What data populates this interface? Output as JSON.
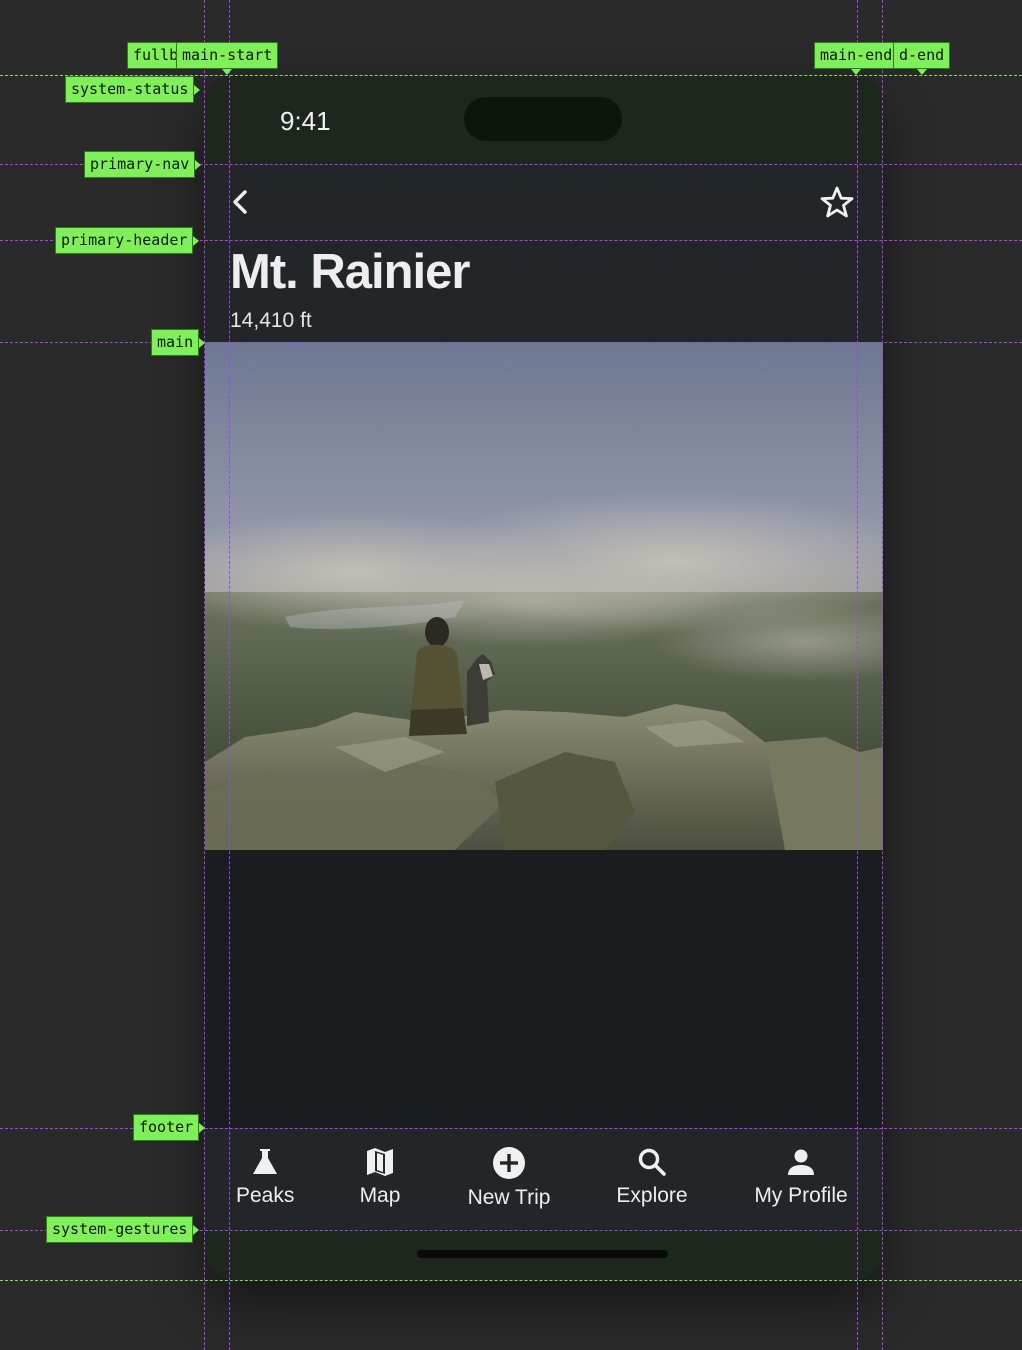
{
  "guides": {
    "fullbleed_start": "fullb",
    "main_start": "main-start",
    "main_end": "main-end",
    "fullbleed_end": "d-end",
    "system_status": "system-status",
    "primary_nav": "primary-nav",
    "primary_header": "primary-header",
    "main": "main",
    "footer": "footer",
    "system_gestures": "system-gestures"
  },
  "status_bar": {
    "time": "9:41"
  },
  "nav": {
    "back_icon": "chevron-left-icon",
    "favorite_icon": "star-icon"
  },
  "header": {
    "title": "Mt. Rainier",
    "subtitle": "14,410 ft"
  },
  "main": {
    "image_description_icon": "landscape-photo"
  },
  "tabbar": {
    "items": [
      {
        "label": "Peaks",
        "icon": "flask-icon"
      },
      {
        "label": "Map",
        "icon": "map-icon"
      },
      {
        "label": "New Trip",
        "icon": "add-circle-icon"
      },
      {
        "label": "Explore",
        "icon": "search-icon"
      },
      {
        "label": "My Profile",
        "icon": "person-icon"
      }
    ]
  },
  "colors": {
    "background": "#2a2a2b",
    "guide_green": "#7fe05a",
    "guide_purple": "#a640e8",
    "surface": "#222629",
    "status_bg": "#1e271d"
  }
}
